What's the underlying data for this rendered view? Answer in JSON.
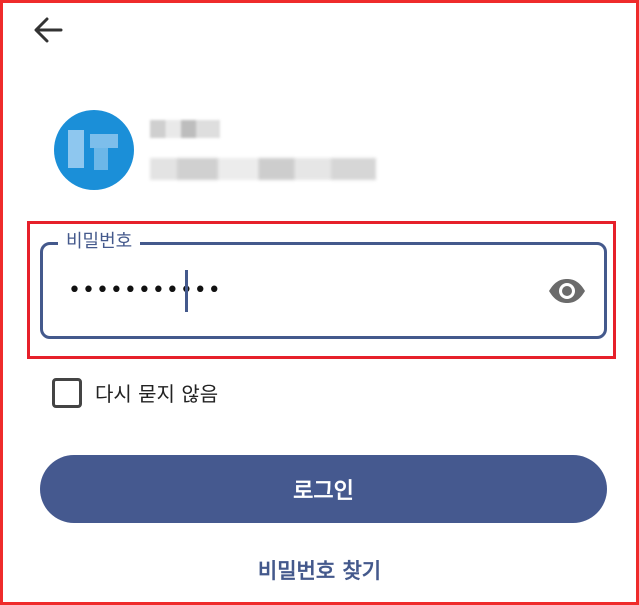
{
  "header": {
    "back_icon": "arrow-left-icon"
  },
  "account": {
    "avatar_text": "",
    "avatar_color": "#1b8fd8"
  },
  "password_field": {
    "label": "비밀번호",
    "masked_value": "•••••••••••",
    "visibility_icon": "eye-icon"
  },
  "remember": {
    "label": "다시 묻지 않음",
    "checked": false
  },
  "actions": {
    "login_label": "로그인",
    "find_password_label": "비밀번호 찾기"
  },
  "colors": {
    "accent": "#45598f",
    "highlight": "#e6202a"
  }
}
